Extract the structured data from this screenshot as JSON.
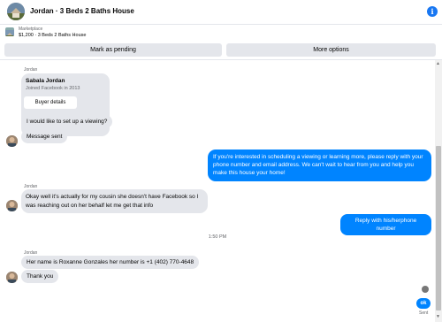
{
  "header": {
    "title": "Jordan · 3 Beds 2 Baths House",
    "info_glyph": "i"
  },
  "banner": {
    "source": "Marketplace",
    "listing": "$1,200 · 3 Beds 2 Baths House"
  },
  "actions": {
    "pending_label": "Mark as pending",
    "more_label": "More options"
  },
  "messages": {
    "sender_1": "Jordan",
    "card_name": "Sabala Jordan",
    "card_sub": "Joined Facebook in 2013",
    "card_button": "Buyer details",
    "m1": "I would like to set up a viewing?",
    "m2": "Message sent",
    "out1": "If you're interested in scheduling a viewing or learning more, please reply with your phone number and email address. We can't wait to hear from you and help you make this house your home!",
    "sender_2": "Jordan",
    "m3": "Okay well it's actually for my cousin she doesn't have Facebook so I was reaching out on her behalf let me get that info",
    "out2": "Reply with his/herphone number",
    "timestamp": "1:50 PM",
    "sender_3": "Jordan",
    "m4": "Her name is Roxanne Gonzales her number is +1 (402) 770-4648",
    "m5": "Thank you",
    "send_label": "ok",
    "sent_label": "Sent"
  },
  "colors": {
    "accent": "#0084ff",
    "bubble_in": "#e4e6eb"
  }
}
